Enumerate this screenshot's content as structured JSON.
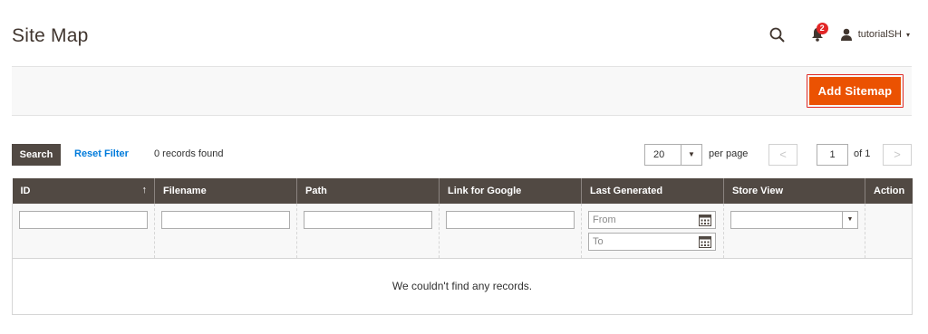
{
  "page": {
    "title": "Site Map"
  },
  "header": {
    "search_icon": "search-icon",
    "notifications_icon": "bell-icon",
    "notifications_count": "2",
    "user_icon": "user-icon",
    "user_name": "tutorialSH",
    "user_caret": "▾"
  },
  "actions": {
    "add_label": "Add Sitemap"
  },
  "grid": {
    "search_label": "Search",
    "reset_label": "Reset Filter",
    "records_found": "0 records found",
    "per_page_value": "20",
    "per_page_label": "per page",
    "current_page": "1",
    "total_pages_label": "of 1",
    "prev_symbol": "<",
    "next_symbol": ">",
    "sort_symbol": "↑",
    "columns": [
      "ID",
      "Filename",
      "Path",
      "Link for Google",
      "Last Generated",
      "Store View",
      "Action"
    ],
    "filters": {
      "date_from_placeholder": "From",
      "date_to_placeholder": "To",
      "store_view_selected": ""
    },
    "empty_message": "We couldn't find any records."
  },
  "colors": {
    "accent": "#eb5202",
    "header_bg": "#514943",
    "link": "#007bdb",
    "badge": "#e22626"
  }
}
